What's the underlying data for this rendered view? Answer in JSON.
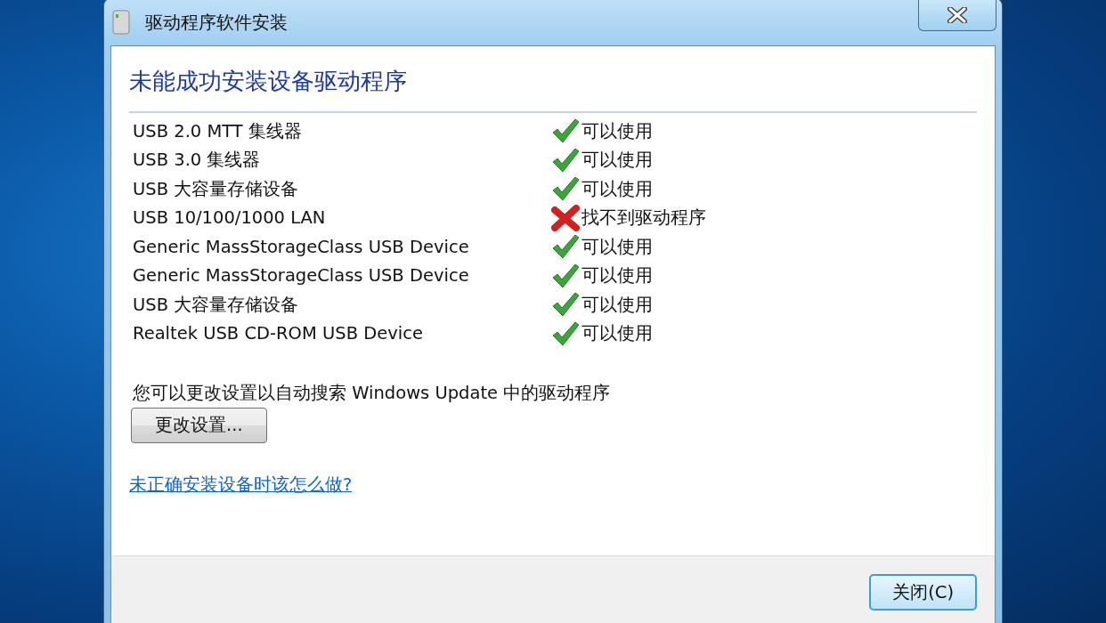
{
  "window": {
    "title": "驱动程序软件安装"
  },
  "heading": "未能成功安装设备驱动程序",
  "devices": [
    {
      "name": "USB 2.0 MTT 集线器",
      "kind": "ok",
      "status_text": "可以使用"
    },
    {
      "name": "USB 3.0 集线器",
      "kind": "ok",
      "status_text": "可以使用"
    },
    {
      "name": "USB 大容量存储设备",
      "kind": "ok",
      "status_text": "可以使用"
    },
    {
      "name": "USB 10/100/1000 LAN",
      "kind": "error",
      "status_text": "找不到驱动程序"
    },
    {
      "name": "Generic MassStorageClass USB Device",
      "kind": "ok",
      "status_text": "可以使用"
    },
    {
      "name": "Generic MassStorageClass USB Device",
      "kind": "ok",
      "status_text": "可以使用"
    },
    {
      "name": "USB 大容量存储设备",
      "kind": "ok",
      "status_text": "可以使用"
    },
    {
      "name": "Realtek USB CD-ROM USB Device",
      "kind": "ok",
      "status_text": "可以使用"
    }
  ],
  "update_hint": "您可以更改设置以自动搜索 Windows Update 中的驱动程序",
  "change_settings_button": "更改设置...",
  "help_link": "未正确安装设备时该怎么做?",
  "close_button": "关闭(C)"
}
